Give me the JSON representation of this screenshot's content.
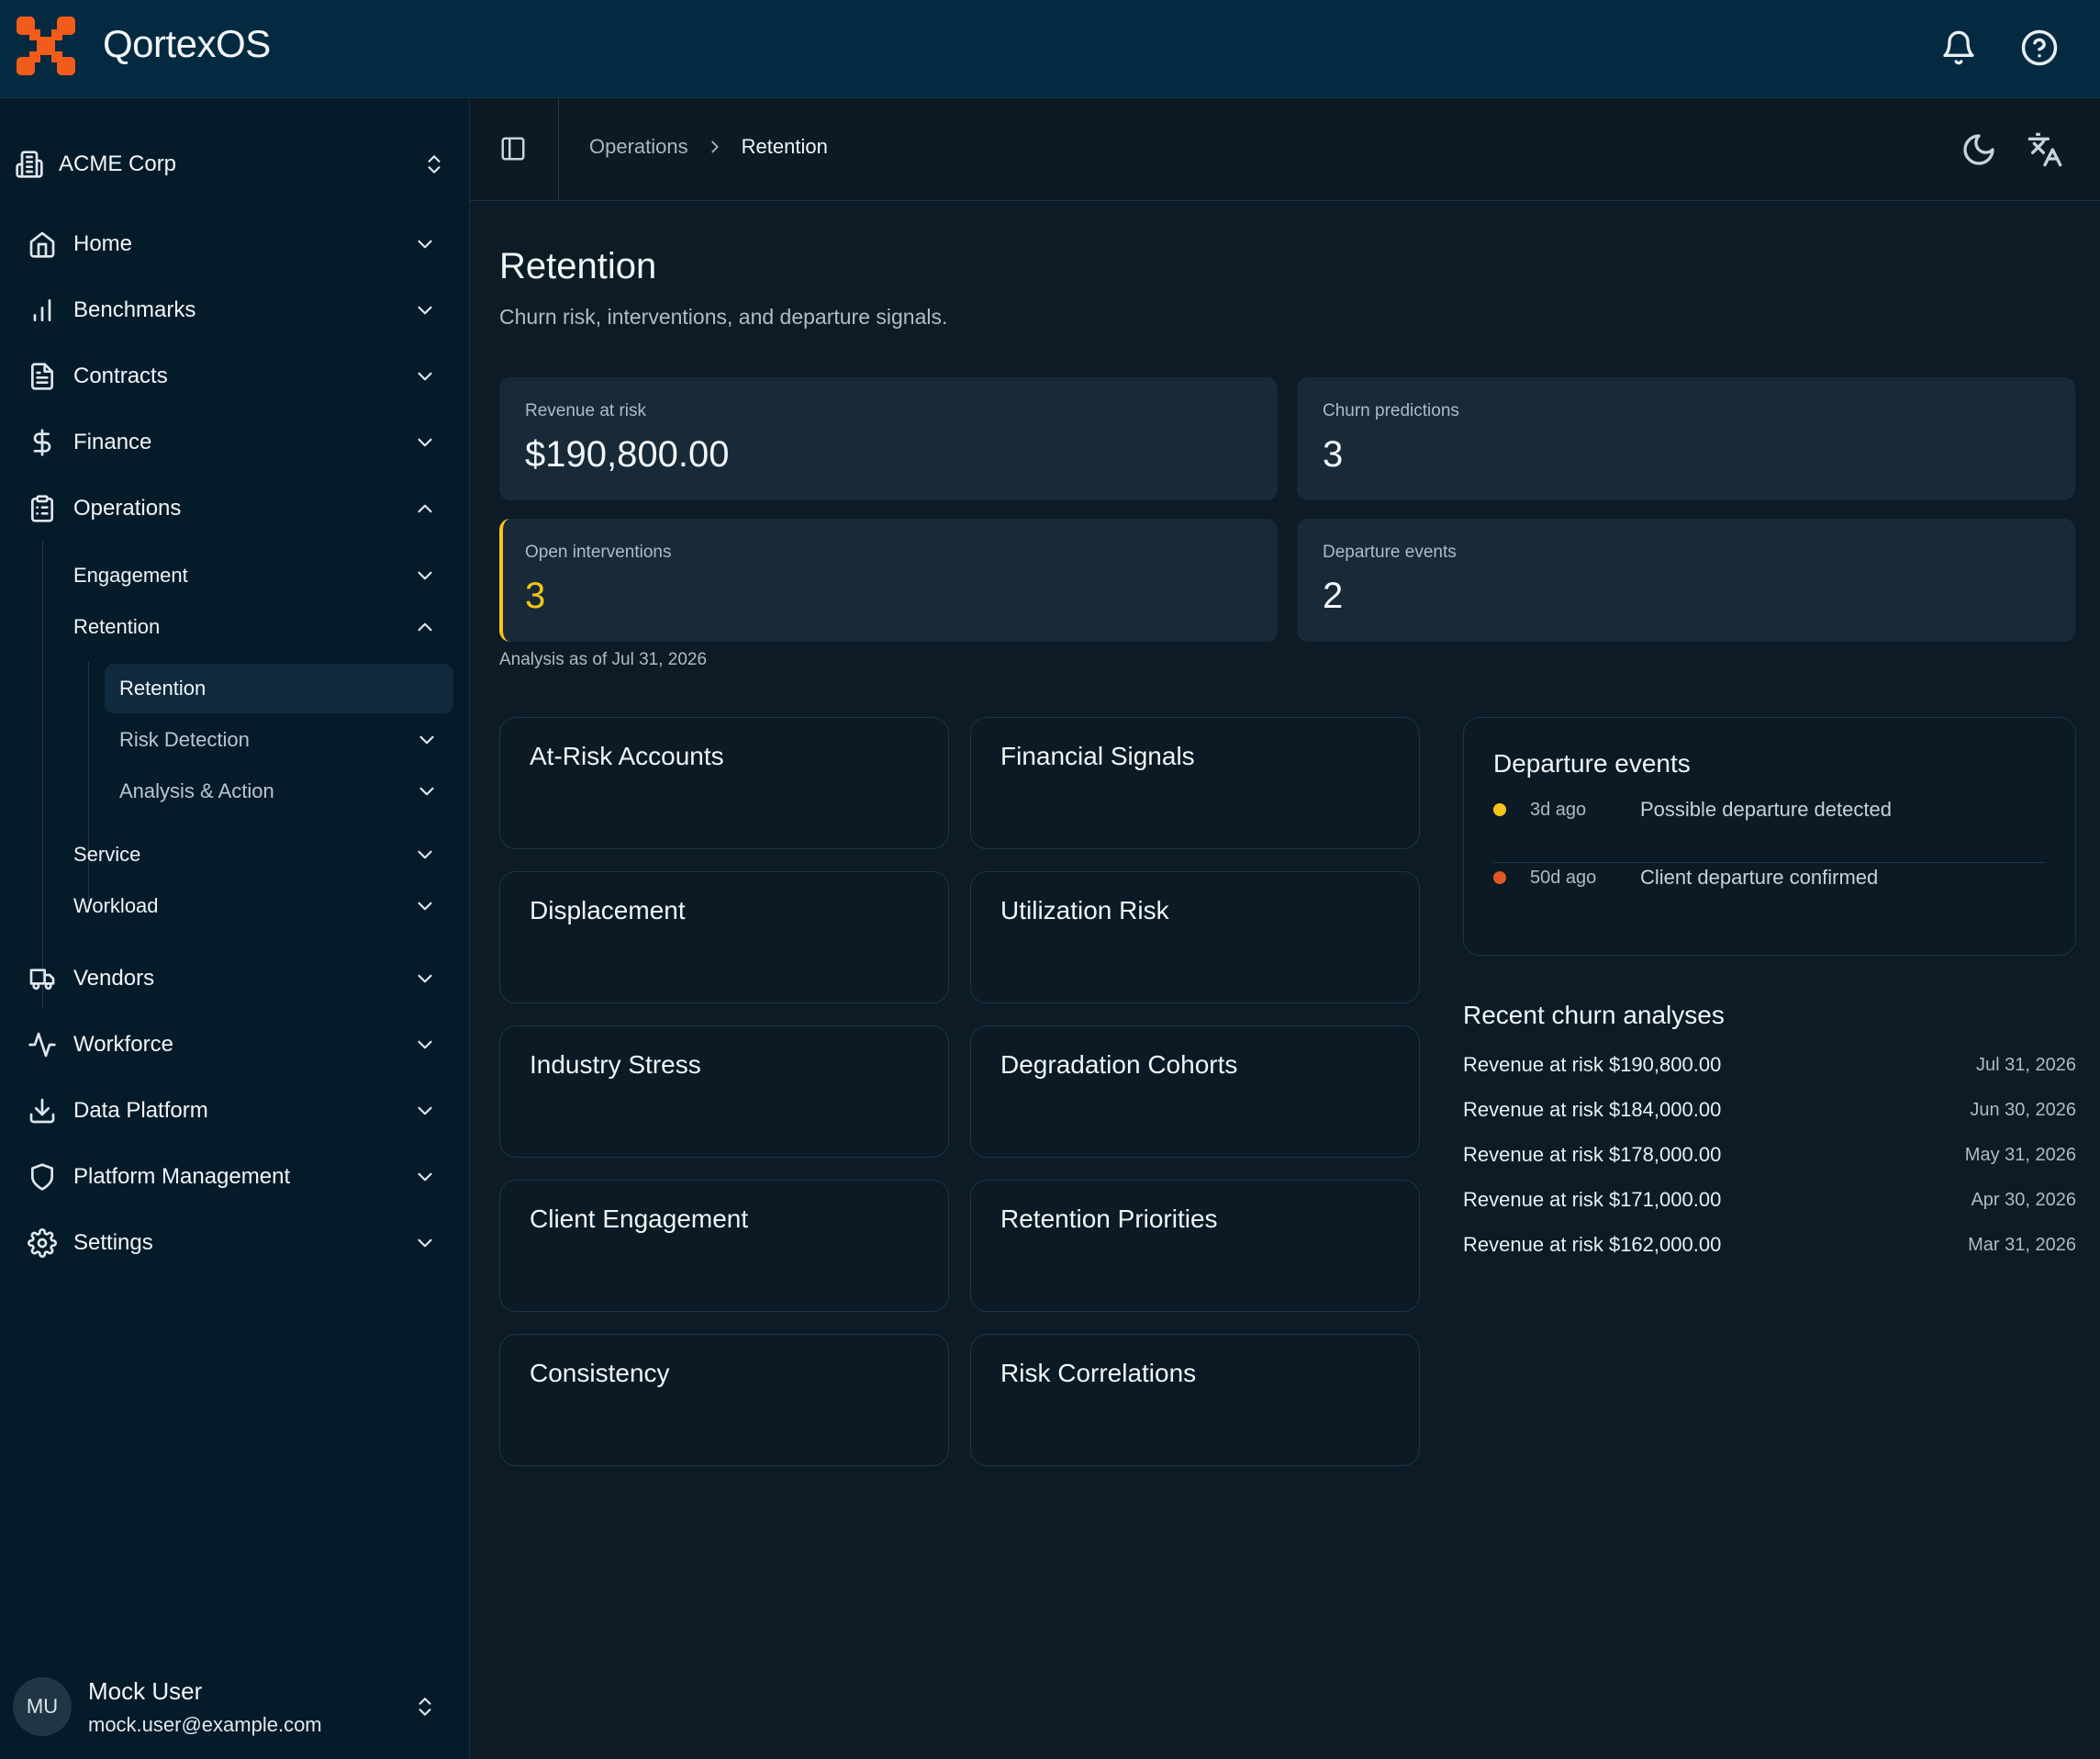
{
  "app": {
    "brand": "QortexOS"
  },
  "colors": {
    "brand_orange": "#f25c1a",
    "topbar": "#032a40",
    "sidebar": "#061b2a",
    "card": "#182a38",
    "warning_yellow": "#f5c518",
    "danger_orange": "#e0582a"
  },
  "topbar": {
    "icons": [
      "bell-icon",
      "help-icon"
    ]
  },
  "sidebar": {
    "org": "ACME Corp",
    "items": [
      {
        "label": "Home",
        "icon": "home-icon"
      },
      {
        "label": "Benchmarks",
        "icon": "bar-chart-icon"
      },
      {
        "label": "Contracts",
        "icon": "document-icon"
      },
      {
        "label": "Finance",
        "icon": "dollar-icon"
      },
      {
        "label": "Operations",
        "icon": "clipboard-icon"
      },
      {
        "label": "Vendors",
        "icon": "truck-icon"
      },
      {
        "label": "Workforce",
        "icon": "activity-icon"
      },
      {
        "label": "Data Platform",
        "icon": "download-icon"
      },
      {
        "label": "Platform Management",
        "icon": "shield-icon"
      },
      {
        "label": "Settings",
        "icon": "gear-icon"
      }
    ],
    "operations_children": [
      {
        "label": "Engagement"
      },
      {
        "label": "Retention"
      },
      {
        "label": "Service"
      },
      {
        "label": "Workload"
      }
    ],
    "retention_children": [
      {
        "label": "Retention"
      },
      {
        "label": "Risk Detection"
      },
      {
        "label": "Analysis & Action"
      }
    ],
    "user": {
      "initials": "MU",
      "name": "Mock User",
      "email": "mock.user@example.com"
    }
  },
  "header": {
    "breadcrumb": [
      "Operations",
      "Retention"
    ],
    "icons": [
      "sidebar-toggle-icon",
      "moon-icon",
      "translate-icon"
    ]
  },
  "page": {
    "title": "Retention",
    "subtitle": "Churn risk, interventions, and departure signals.",
    "stats": [
      {
        "label": "Revenue at risk",
        "value": "$190,800.00"
      },
      {
        "label": "Churn predictions",
        "value": "3"
      },
      {
        "label": "Open interventions",
        "value": "3"
      },
      {
        "label": "Departure events",
        "value": "2"
      }
    ],
    "as_of": "Analysis as of Jul 31, 2026",
    "cards": [
      "At-Risk Accounts",
      "Financial Signals",
      "Displacement",
      "Utilization Risk",
      "Industry Stress",
      "Degradation Cohorts",
      "Client Engagement",
      "Retention Priorities",
      "Consistency",
      "Risk Correlations"
    ],
    "departure_events": {
      "title": "Departure events",
      "rows": [
        {
          "ago": "3d ago",
          "text": "Possible departure detected",
          "dot": "#f5c518"
        },
        {
          "ago": "50d ago",
          "text": "Client departure confirmed",
          "dot": "#e0582a"
        }
      ]
    },
    "recent": {
      "title": "Recent churn analyses",
      "rows": [
        {
          "label": "Revenue at risk $190,800.00",
          "date": "Jul 31, 2026"
        },
        {
          "label": "Revenue at risk $184,000.00",
          "date": "Jun 30, 2026"
        },
        {
          "label": "Revenue at risk $178,000.00",
          "date": "May 31, 2026"
        },
        {
          "label": "Revenue at risk $171,000.00",
          "date": "Apr 30, 2026"
        },
        {
          "label": "Revenue at risk $162,000.00",
          "date": "Mar 31, 2026"
        }
      ]
    }
  }
}
